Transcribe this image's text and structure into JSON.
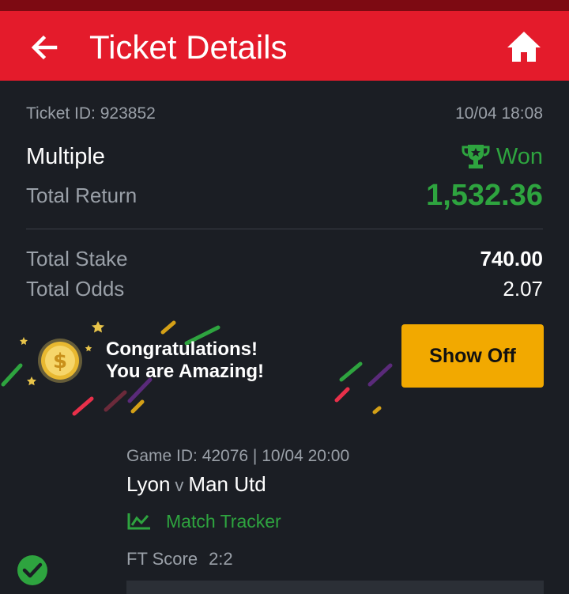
{
  "header": {
    "title": "Ticket Details",
    "back_icon": "arrow-left-icon",
    "home_icon": "home-icon"
  },
  "ticket": {
    "id_text": "Ticket ID: 923852",
    "datetime": "10/04 18:08",
    "bet_type": "Multiple",
    "status": "Won",
    "total_return_label": "Total Return",
    "total_return_value": "1,532.36",
    "total_stake_label": "Total Stake",
    "total_stake_value": "740.00",
    "total_odds_label": "Total Odds",
    "total_odds_value": "2.07"
  },
  "banner": {
    "line1": "Congratulations!",
    "line2": "You are Amazing!",
    "button_label": "Show Off"
  },
  "game": {
    "meta": "Game ID: 42076 | 10/04 20:00",
    "home_team": "Lyon",
    "vs": "v",
    "away_team": "Man Utd",
    "tracker_label": "Match Tracker",
    "score_label": "FT Score",
    "score_value": "2:2"
  },
  "colors": {
    "header_red": "#e41b2b",
    "win_green": "#2ea43f",
    "button_gold": "#f2a900",
    "background": "#1b1e24"
  }
}
